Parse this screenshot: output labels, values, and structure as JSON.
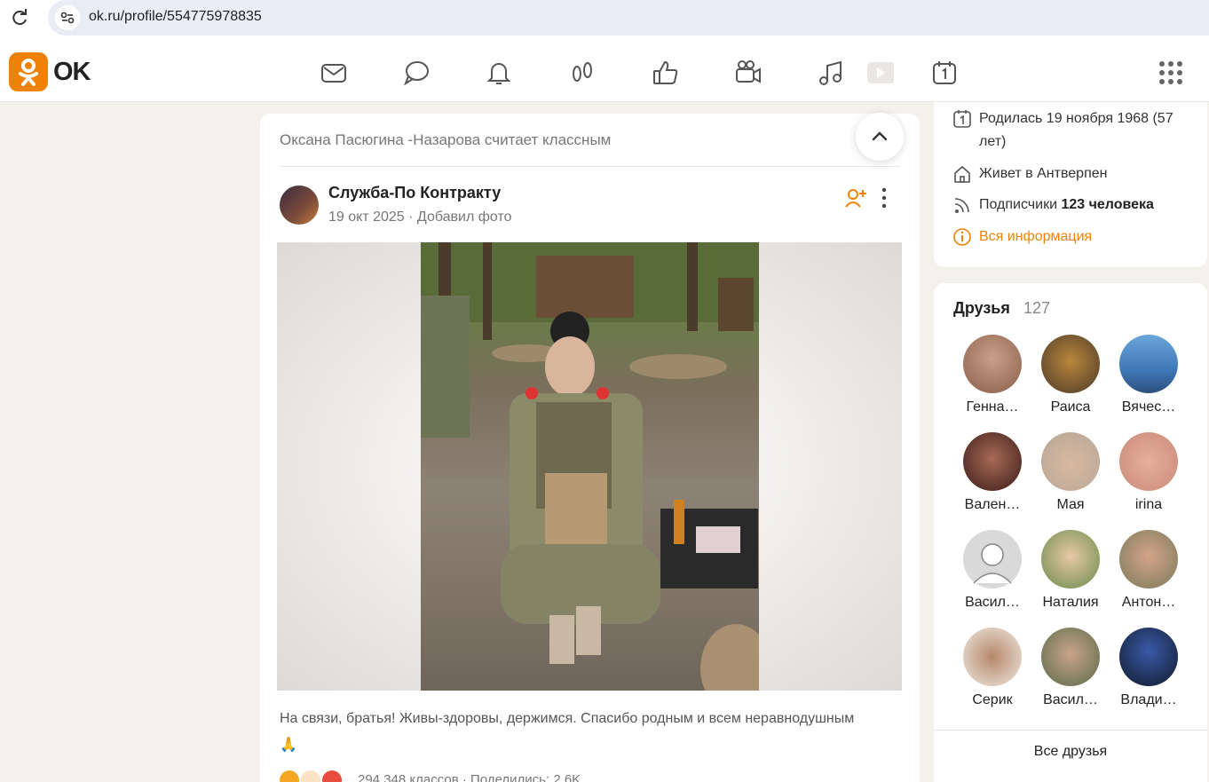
{
  "browser": {
    "url": "ok.ru/profile/554775978835"
  },
  "header": {
    "logo_text": "OK",
    "nav_icons": [
      "mail-icon",
      "chat-icon",
      "bell-icon",
      "guests-icon",
      "like-icon",
      "video-icon",
      "music-icon",
      "play-icon",
      "calendar-icon"
    ],
    "apps_icon": "grid-icon",
    "accent_color": "#ee8208"
  },
  "feed": {
    "context": "Оксана Пасюгина -Назарова считает классным",
    "post": {
      "author": "Служба-По Контракту",
      "date": "19 окт 2025",
      "separator": "·",
      "action": "Добавил фото",
      "text": "На связи, братья! Живы-здоровы, держимся. Спасибо родным и всем неравнодушным",
      "text_emoji": "🙏",
      "stats": "294 348 классов  ·  Поделились: 2,6K"
    }
  },
  "profile_info": {
    "birthday": "Родилась 19 ноября 1968 (57 лет)",
    "lives": "Живет в Антверпен",
    "followers_label": "Подписчики",
    "followers_value": "123 человека",
    "all_info": "Вся информация"
  },
  "friends": {
    "title": "Друзья",
    "count": "127",
    "items": [
      {
        "name": "Генна…"
      },
      {
        "name": "Раиса"
      },
      {
        "name": "Вячес…"
      },
      {
        "name": "Вален…"
      },
      {
        "name": "Мая"
      },
      {
        "name": "irina"
      },
      {
        "name": "Васил…"
      },
      {
        "name": "Наталия"
      },
      {
        "name": "Антон…"
      },
      {
        "name": "Серик"
      },
      {
        "name": "Васил…"
      },
      {
        "name": "Влади…"
      }
    ],
    "all_label": "Все друзья"
  }
}
